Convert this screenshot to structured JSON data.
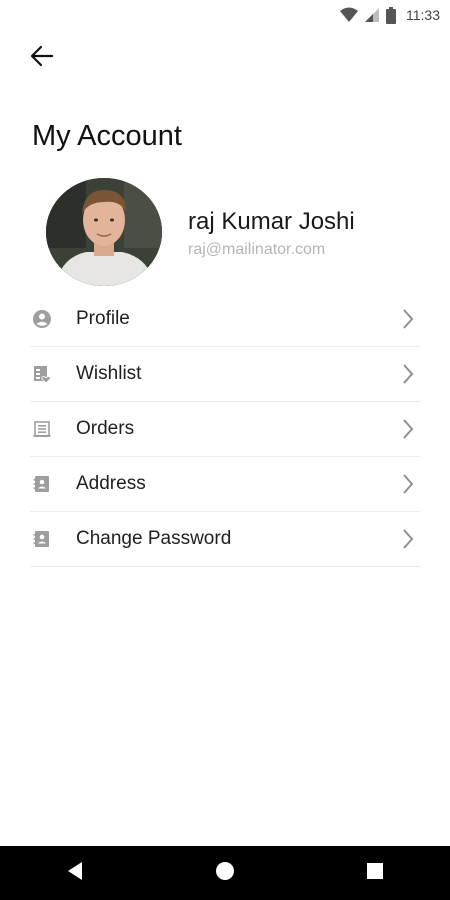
{
  "status_bar": {
    "time": "11:33",
    "icons": [
      "wifi-icon",
      "signal-icon",
      "battery-icon"
    ]
  },
  "header": {
    "back_icon": "arrow-left-icon",
    "title": "My Account"
  },
  "profile": {
    "name": "raj Kumar Joshi",
    "email": "raj@mailinator.com"
  },
  "menu": {
    "items": [
      {
        "label": "Profile",
        "icon": "account-circle-icon"
      },
      {
        "label": "Wishlist",
        "icon": "wishlist-icon"
      },
      {
        "label": "Orders",
        "icon": "orders-icon"
      },
      {
        "label": "Address",
        "icon": "contact-card-icon"
      },
      {
        "label": "Change Password",
        "icon": "contact-card-icon"
      }
    ],
    "chevron_icon": "chevron-right-icon"
  },
  "nav_bar": {
    "buttons": [
      "back-triangle-icon",
      "home-circle-icon",
      "recents-square-icon"
    ]
  },
  "colors": {
    "background": "#ffffff",
    "divider": "#ececec",
    "icon_grey": "#9e9e9e",
    "email_grey": "#b5b5b5",
    "nav_bar": "#000000"
  }
}
